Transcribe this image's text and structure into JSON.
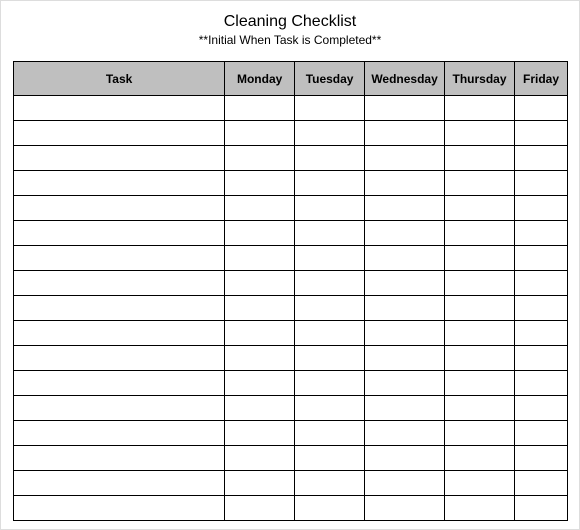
{
  "title": "Cleaning Checklist",
  "subtitle": "**Initial When Task is Completed**",
  "columns": {
    "task": "Task",
    "monday": "Monday",
    "tuesday": "Tuesday",
    "wednesday": "Wednesday",
    "thursday": "Thursday",
    "friday": "Friday"
  },
  "rows": [
    {
      "task": "",
      "monday": "",
      "tuesday": "",
      "wednesday": "",
      "thursday": "",
      "friday": ""
    },
    {
      "task": "",
      "monday": "",
      "tuesday": "",
      "wednesday": "",
      "thursday": "",
      "friday": ""
    },
    {
      "task": "",
      "monday": "",
      "tuesday": "",
      "wednesday": "",
      "thursday": "",
      "friday": ""
    },
    {
      "task": "",
      "monday": "",
      "tuesday": "",
      "wednesday": "",
      "thursday": "",
      "friday": ""
    },
    {
      "task": "",
      "monday": "",
      "tuesday": "",
      "wednesday": "",
      "thursday": "",
      "friday": ""
    },
    {
      "task": "",
      "monday": "",
      "tuesday": "",
      "wednesday": "",
      "thursday": "",
      "friday": ""
    },
    {
      "task": "",
      "monday": "",
      "tuesday": "",
      "wednesday": "",
      "thursday": "",
      "friday": ""
    },
    {
      "task": "",
      "monday": "",
      "tuesday": "",
      "wednesday": "",
      "thursday": "",
      "friday": ""
    },
    {
      "task": "",
      "monday": "",
      "tuesday": "",
      "wednesday": "",
      "thursday": "",
      "friday": ""
    },
    {
      "task": "",
      "monday": "",
      "tuesday": "",
      "wednesday": "",
      "thursday": "",
      "friday": ""
    },
    {
      "task": "",
      "monday": "",
      "tuesday": "",
      "wednesday": "",
      "thursday": "",
      "friday": ""
    },
    {
      "task": "",
      "monday": "",
      "tuesday": "",
      "wednesday": "",
      "thursday": "",
      "friday": ""
    },
    {
      "task": "",
      "monday": "",
      "tuesday": "",
      "wednesday": "",
      "thursday": "",
      "friday": ""
    },
    {
      "task": "",
      "monday": "",
      "tuesday": "",
      "wednesday": "",
      "thursday": "",
      "friday": ""
    },
    {
      "task": "",
      "monday": "",
      "tuesday": "",
      "wednesday": "",
      "thursday": "",
      "friday": ""
    },
    {
      "task": "",
      "monday": "",
      "tuesday": "",
      "wednesday": "",
      "thursday": "",
      "friday": ""
    },
    {
      "task": "",
      "monday": "",
      "tuesday": "",
      "wednesday": "",
      "thursday": "",
      "friday": ""
    }
  ]
}
